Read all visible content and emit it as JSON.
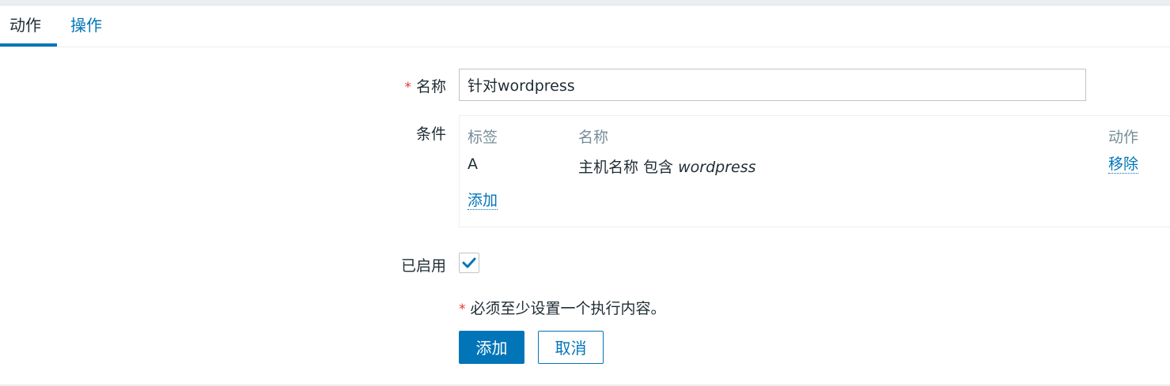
{
  "tabs": [
    {
      "label": "动作",
      "active": true
    },
    {
      "label": "操作",
      "active": false
    }
  ],
  "form": {
    "name_label": "名称",
    "required_mark": "*",
    "name_value": "针对wordpress",
    "conditions_label": "条件",
    "conditions": {
      "headers": {
        "tag": "标签",
        "name": "名称",
        "action": "动作"
      },
      "rows": [
        {
          "tag": "A",
          "name_prefix": "主机名称 包含 ",
          "name_value": "wordpress",
          "action": "移除"
        }
      ],
      "add_link": "添加"
    },
    "enabled_label": "已启用",
    "enabled": true,
    "note_mark": "*",
    "note_text": "必须至少设置一个执行内容。"
  },
  "buttons": {
    "add": "添加",
    "cancel": "取消"
  },
  "colors": {
    "accent": "#0275b8",
    "required": "#e33734",
    "header_gray": "#768d99"
  }
}
